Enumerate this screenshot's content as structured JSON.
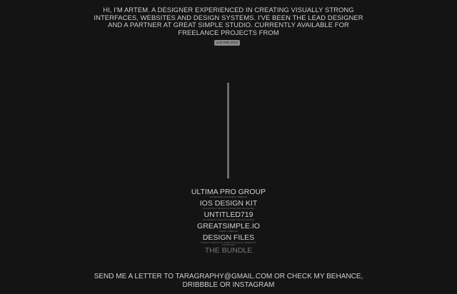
{
  "intro": {
    "lines": [
      "HI, I'M ARTEM. A DESIGNER EXPERIENCED IN CREATING VISUALLY STRONG",
      "INTERFACES, WEBSITES AND DESIGN SYSTEMS. I'VE BEEN THE LEAD DESIGNER",
      "AND A PARTNER AT GREAT SIMPLE STUDIO. CURRENTLY AVAILABLE FOR",
      "FREELANCE PROJECTS FROM"
    ],
    "date_badge": "20 FEB 2019"
  },
  "projects": [
    {
      "title": "ULTIMA PRO GROUP",
      "desc": "ENTERPRISE INVESTMENT WEBSITE"
    },
    {
      "title": "IOS DESIGN KIT",
      "desc": "iOS PRODUCT DESIGN KIT DIRECTOR AND DESIGN"
    },
    {
      "title": "UNTITLED719",
      "desc": "iOS PRODUCT DESIGN KIT DIRECTOR AND DESIGN"
    },
    {
      "title": "GREATSIMPLE.IO",
      "desc": "AGENCY WEBSITE"
    },
    {
      "title": "DESIGN FILES",
      "desc": "PRODUCT DESIGN KIT DIRECTOR FOR ALL PRODUCTS AND DESIGN"
    },
    {
      "title": "THE BUNDLE",
      "desc": ""
    }
  ],
  "contact": {
    "prefix": "SEND ME A LETTER TO ",
    "email": "TARAGRAPHY@GMAIL.COM",
    "mid": " OR CHECK MY ",
    "behance": "BEHANCE",
    "sep": ", ",
    "dribbble": "DRIBBBLE",
    "or": " OR ",
    "instagram": "INSTAGRAM"
  }
}
